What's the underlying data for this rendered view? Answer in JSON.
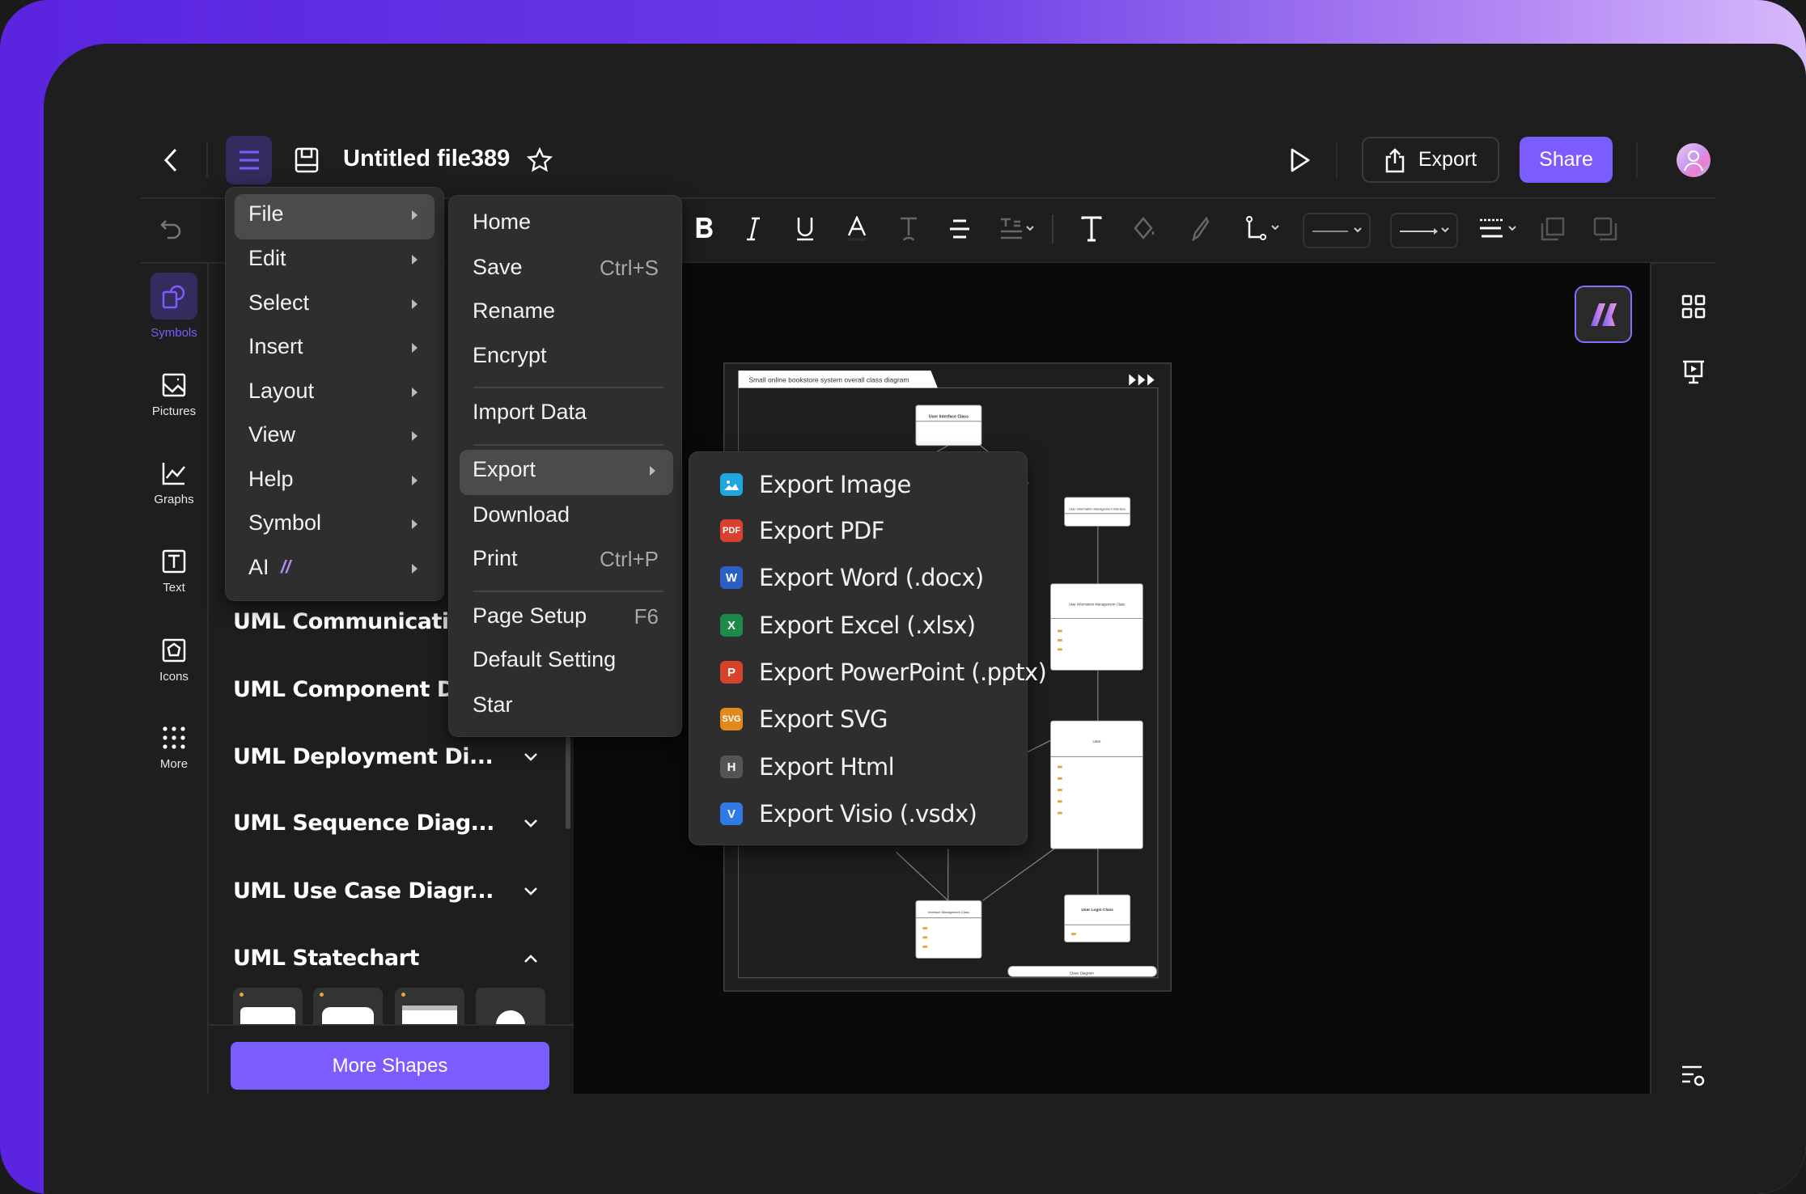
{
  "header": {
    "title": "Untitled file389",
    "export_label": "Export",
    "share_label": "Share"
  },
  "colors": {
    "accent": "#7b5cff",
    "menu_bg": "#2e2e2e",
    "canvas_bg": "#0a0a0a"
  },
  "rail": {
    "items": [
      {
        "label": "Symbols",
        "icon": "symbols-icon",
        "active": true
      },
      {
        "label": "Pictures",
        "icon": "picture-icon"
      },
      {
        "label": "Graphs",
        "icon": "graph-icon"
      },
      {
        "label": "Text",
        "icon": "text-icon"
      },
      {
        "label": "Icons",
        "icon": "icons-icon"
      },
      {
        "label": "More",
        "icon": "grid-dots-icon"
      }
    ]
  },
  "library": {
    "categories": [
      {
        "label": "UML Communicatio..",
        "expanded": false
      },
      {
        "label": "UML Component Di..",
        "expanded": false
      },
      {
        "label": "UML Deployment Di...",
        "expanded": false
      },
      {
        "label": "UML Sequence Diag...",
        "expanded": false
      },
      {
        "label": "UML Use Case Diagr...",
        "expanded": false
      },
      {
        "label": "UML Statechart",
        "expanded": true
      }
    ],
    "more_shapes_label": "More Shapes"
  },
  "main_menu": {
    "items": [
      {
        "label": "File",
        "active": true
      },
      {
        "label": "Edit"
      },
      {
        "label": "Select"
      },
      {
        "label": "Insert"
      },
      {
        "label": "Layout"
      },
      {
        "label": "View"
      },
      {
        "label": "Help"
      },
      {
        "label": "Symbol"
      },
      {
        "label": "AI"
      }
    ]
  },
  "file_menu": {
    "items": [
      {
        "label": "Home",
        "shortcut": ""
      },
      {
        "label": "Save",
        "shortcut": "Ctrl+S"
      },
      {
        "label": "Rename",
        "shortcut": ""
      },
      {
        "label": "Encrypt",
        "shortcut": ""
      },
      {
        "label": "Import Data",
        "shortcut": ""
      },
      {
        "label": "Export",
        "shortcut": "",
        "active": true
      },
      {
        "label": "Download",
        "shortcut": ""
      },
      {
        "label": "Print",
        "shortcut": "Ctrl+P"
      },
      {
        "label": "Page Setup",
        "shortcut": "F6"
      },
      {
        "label": "Default Setting",
        "shortcut": ""
      },
      {
        "label": "Star",
        "shortcut": ""
      }
    ]
  },
  "export_menu": {
    "items": [
      {
        "label": "Export Image",
        "badge": "",
        "color": "#1ea7de",
        "icon": "image-icon"
      },
      {
        "label": "Export PDF",
        "badge": "PDF",
        "color": "#d9412e",
        "icon": "pdf-icon"
      },
      {
        "label": "Export Word (.docx)",
        "badge": "W",
        "color": "#2b5fc4",
        "icon": "word-icon"
      },
      {
        "label": "Export Excel (.xlsx)",
        "badge": "X",
        "color": "#1e8a47",
        "icon": "excel-icon"
      },
      {
        "label": "Export PowerPoint (.pptx)",
        "badge": "P",
        "color": "#d6432a",
        "icon": "powerpoint-icon"
      },
      {
        "label": "Export SVG",
        "badge": "SVG",
        "color": "#e08a1e",
        "icon": "svg-icon"
      },
      {
        "label": "Export Html",
        "badge": "H",
        "color": "#555555",
        "icon": "html-icon"
      },
      {
        "label": "Export Visio (.vsdx)",
        "badge": "V",
        "color": "#2f7ae5",
        "icon": "visio-icon"
      }
    ]
  },
  "diagram": {
    "title": "Small online bookstore system overall class diagram",
    "classes": {
      "ui": "User Interface Class",
      "uim_interface": "User Information Management Interface",
      "uim_class": "User Information Management Class",
      "user": "User",
      "interface_mgmt": "Interface Management Class",
      "login": "User Login Class"
    },
    "footer": "Class Diagram"
  }
}
